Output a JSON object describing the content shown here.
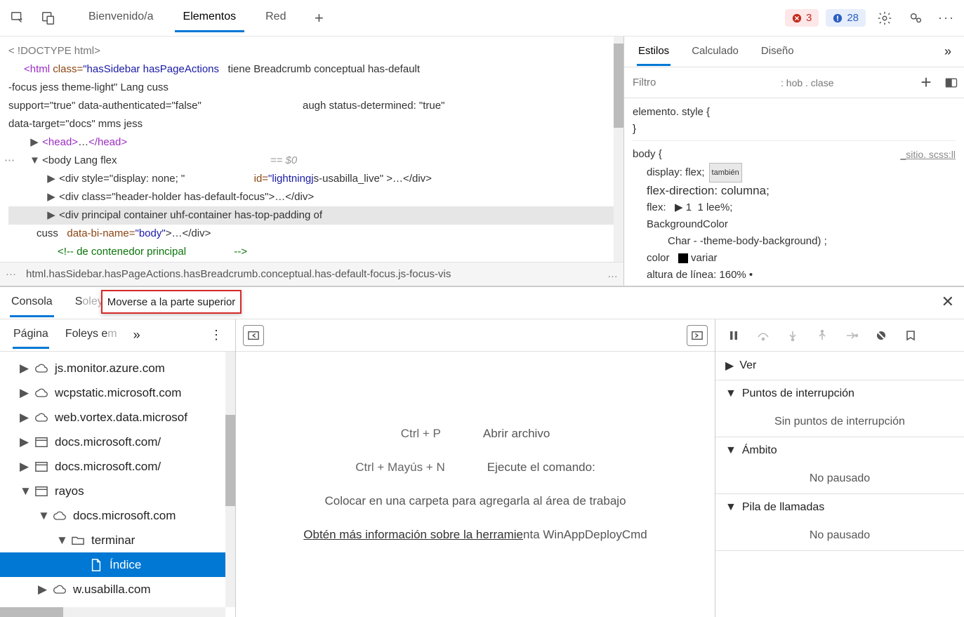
{
  "toolbar": {
    "tabs": [
      "Bienvenido/a",
      "Elementos",
      "Red"
    ],
    "active_tab": 1,
    "errors": "3",
    "messages": "28"
  },
  "elements": {
    "doctype": "< !DOCTYPE html>",
    "html_open": "<html",
    "html_class_attr": "class=",
    "html_class_val": "\"hasSidebar hasPageActions",
    "html_rest1": "tiene Breadcrumb conceptual has-default",
    "html_rest2": "-focus jess theme-light\" Lang cuss",
    "html_rest3": "support=\"true\" data-authenticated=\"false\"",
    "html_rest4": "augh status-determined: \"true\"",
    "html_rest5": "data-target=\"docs\" mms jess",
    "head": "<head>…</head>",
    "body_open": "<body Lang flex",
    "badge": "== $0",
    "div1_a": "<div style=\"display: none; \"",
    "div1_b": "id=",
    "div1_c": "\"lightningj",
    "div1_d": "s-usabilla_live\" >…</div>",
    "div2": "<div class=\"header-holder has-default-focus\">…</div>",
    "div3": "<div principal container uhf-container has-top-padding of",
    "div3b_a": "cuss",
    "div3b_b": "data-bi-name=",
    "div3b_c": "\"body\"",
    "div3b_d": ">…</div>",
    "comment_a": "<!-- de contenedor principal",
    "comment_b": "-->",
    "breadcrumb": "html.hasSidebar.hasPageActions.hasBreadcrumb.conceptual.has-default-focus.js-focus-vis",
    "breadcrumb_more": "…"
  },
  "styles": {
    "tabs": [
      "Estilos",
      "Calculado",
      "Diseño"
    ],
    "active_tab": 0,
    "filter_placeholder": "Filtro",
    "hov_cls": ": hob  . clase",
    "r1_sel": "elemento. style {",
    "r1_close": "}",
    "r2_sel": "body {",
    "r2_src": "_sitio. scss:ll",
    "r2_p1": "display: flex;",
    "r2_badge": "también",
    "r2_p2": "flex-direction: columna;",
    "r2_p3a": "flex:",
    "r2_p3b": "1",
    "r2_p3c": "1 lee%;",
    "r2_p4": "BackgroundColor",
    "r2_p5": "Char - -theme-body-background) ;",
    "r2_p6a": "color",
    "r2_p6b": "variar",
    "r2_p7": "altura de línea: 160% •"
  },
  "drawer": {
    "tabs": [
      "Consola",
      "S"
    ],
    "foleys_extra": "oleys e m",
    "context_menu": "Moverse a la parte superior"
  },
  "sources": {
    "left_tabs": [
      "Página",
      "Foleys e"
    ],
    "left_tabs_extra": "m",
    "tree": [
      {
        "icon": "cloud",
        "label": "js.monitor.azure.com",
        "depth": 0
      },
      {
        "icon": "cloud",
        "label": "wcpstatic.microsoft.com",
        "depth": 0
      },
      {
        "icon": "cloud",
        "label": "web.vortex.data.microsof",
        "depth": 0
      },
      {
        "icon": "window",
        "label": "docs.microsoft.com/",
        "depth": 0
      },
      {
        "icon": "window",
        "label": "docs.microsoft.com/",
        "depth": 0
      },
      {
        "icon": "window",
        "label": "rayos",
        "depth": 0,
        "expanded": true
      },
      {
        "icon": "cloud",
        "label": "docs.microsoft.com",
        "depth": 1,
        "expanded": true
      },
      {
        "icon": "folder",
        "label": "terminar",
        "depth": 2,
        "expanded": true
      },
      {
        "icon": "file",
        "label": "Índice",
        "depth": 3,
        "selected": true
      },
      {
        "icon": "cloud",
        "label": "w.usabilla.com",
        "depth": 1
      }
    ],
    "mid": {
      "k1": "Ctrl + P",
      "v1": "Abrir archivo",
      "k2": "Ctrl + Mayús + N",
      "v2": "Ejecute el comando:",
      "drop": "Colocar en una carpeta para agregarla al área de trabajo",
      "link": "Obtén más información sobre la herramie",
      "link_tail": "nta WinAppDeployCmd"
    },
    "right": {
      "ver": "Ver",
      "bp": "Puntos de interrupción",
      "bp_body": "Sin puntos de interrupción",
      "scope": "Ámbito",
      "scope_body": "No pausado",
      "stack": "Pila de llamadas",
      "stack_body": "No pausado"
    }
  }
}
